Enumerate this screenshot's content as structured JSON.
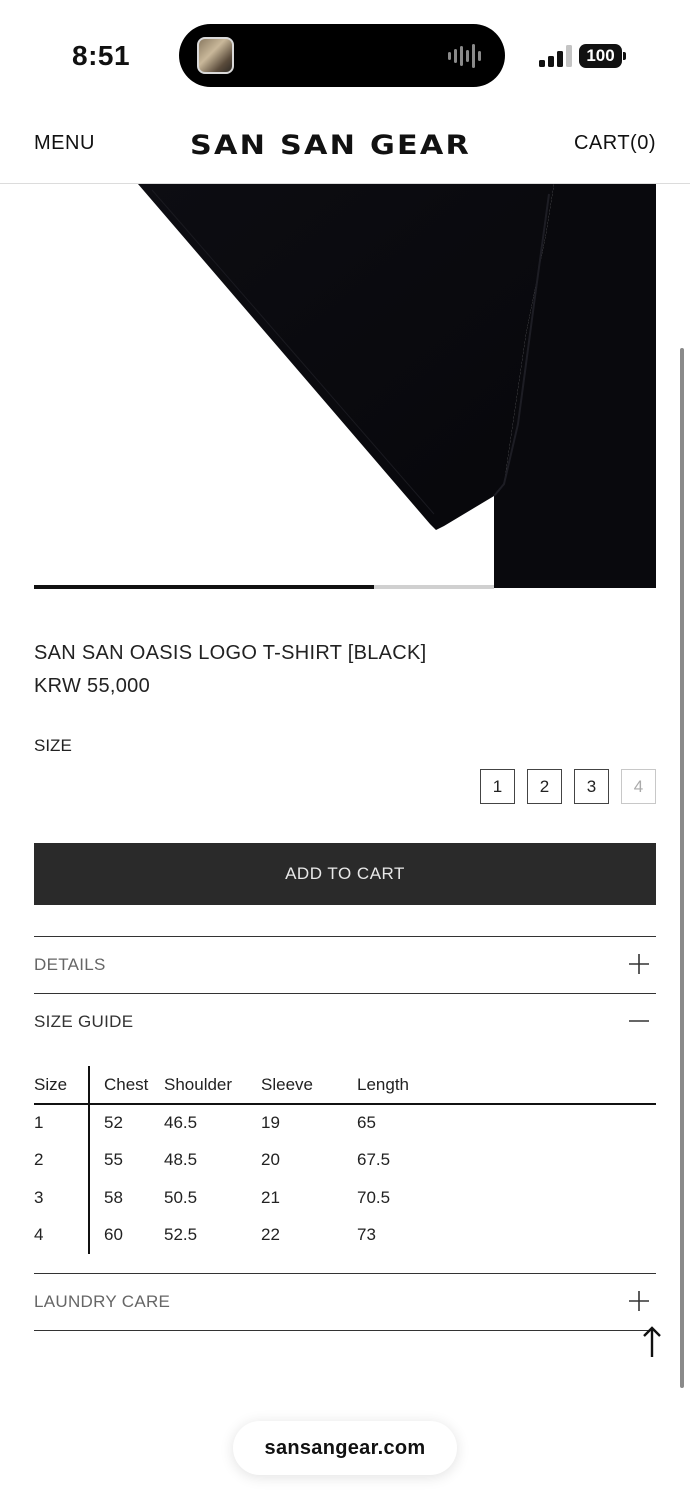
{
  "status_bar": {
    "time": "8:51",
    "battery": "100",
    "icons": [
      "now-playing-thumbnail",
      "audio-wave-icon",
      "signal-icon",
      "battery-icon"
    ]
  },
  "header": {
    "menu_label": "MENU",
    "brand": "SAN SAN GEAR",
    "cart_label": "CART(0)"
  },
  "product": {
    "name": "SAN SAN OASIS LOGO T-SHIRT [BLACK]",
    "price": "KRW 55,000",
    "size_label": "SIZE",
    "sizes": [
      {
        "label": "1",
        "available": true
      },
      {
        "label": "2",
        "available": true
      },
      {
        "label": "3",
        "available": true
      },
      {
        "label": "4",
        "available": false
      }
    ],
    "add_to_cart_label": "ADD TO CART",
    "image_carousel_progress": 0.74
  },
  "accordion": {
    "details": {
      "title": "DETAILS",
      "state": "collapsed",
      "icon": "plus-icon"
    },
    "size_guide": {
      "title": "SIZE GUIDE",
      "state": "expanded",
      "icon": "minus-icon"
    },
    "laundry_care": {
      "title": "LAUNDRY CARE",
      "state": "collapsed",
      "icon": "plus-icon"
    }
  },
  "size_guide_table": {
    "headers": [
      "Size",
      "Chest",
      "Shoulder",
      "Sleeve",
      "Length"
    ],
    "rows": [
      [
        "1",
        "52",
        "46.5",
        "19",
        "65"
      ],
      [
        "2",
        "55",
        "48.5",
        "20",
        "67.5"
      ],
      [
        "3",
        "58",
        "50.5",
        "21",
        "70.5"
      ],
      [
        "4",
        "60",
        "52.5",
        "22",
        "73"
      ]
    ]
  },
  "browser": {
    "url": "sansangear.com"
  },
  "colors": {
    "button_bg": "#2a2a2a",
    "text": "#1a1a1a",
    "garment": "#0b0b10"
  }
}
